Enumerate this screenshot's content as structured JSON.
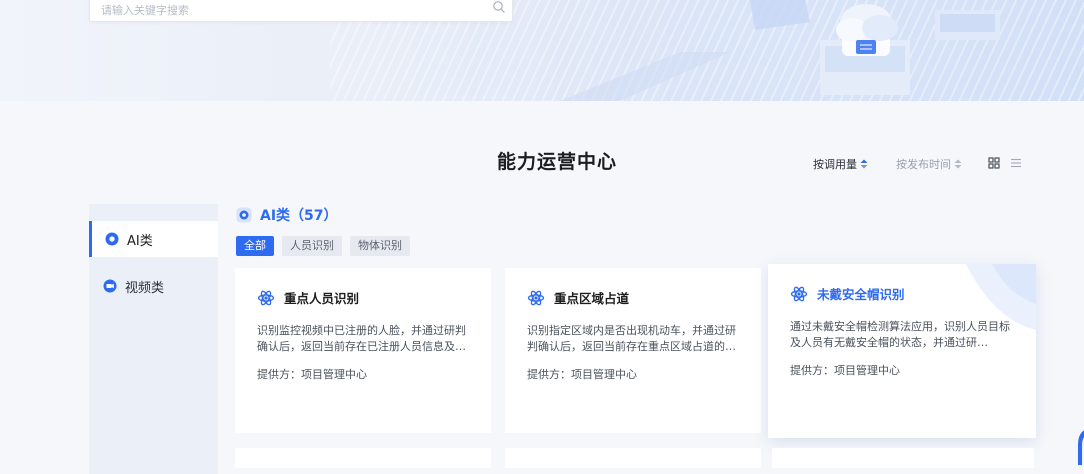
{
  "search": {
    "placeholder": "请输入关键字搜索"
  },
  "page": {
    "title": "能力运营中心"
  },
  "sort": {
    "by_calls": "按调用量",
    "by_time": "按发布时间"
  },
  "sidebar": {
    "items": [
      {
        "label": "AI类",
        "active": true
      },
      {
        "label": "视频类",
        "active": false
      }
    ]
  },
  "category": {
    "title": "AI类（57）",
    "tabs": [
      {
        "label": "全部",
        "active": true
      },
      {
        "label": "人员识别",
        "active": false
      },
      {
        "label": "物体识别",
        "active": false
      }
    ]
  },
  "cards": [
    {
      "title": "重点人员识别",
      "description": "识别监控视频中已注册的人脸，并通过研判确认后，返回当前存在已注册人员信息及…",
      "provider": "提供方：项目管理中心"
    },
    {
      "title": "重点区域占道",
      "description": "识别指定区域内是否出现机动车，并通过研判确认后，返回当前存在重点区域占道的…",
      "provider": "提供方：项目管理中心"
    },
    {
      "title": "未戴安全帽识别",
      "description": "通过未戴安全帽检测算法应用，识别人员目标及人员有无戴安全帽的状态，并通过研…",
      "provider": "提供方：项目管理中心"
    }
  ],
  "colors": {
    "accent": "#2f6bf0",
    "sidebar_bg": "#ebf0f8",
    "page_bg": "#f5f7fb"
  }
}
